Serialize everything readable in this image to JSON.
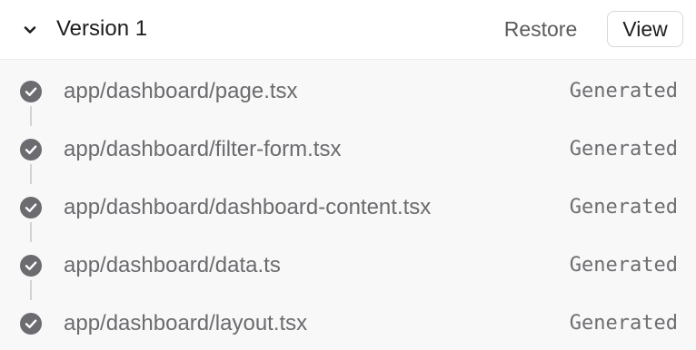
{
  "header": {
    "expand_icon": "chevron-down-icon",
    "title": "Version 1",
    "restore_label": "Restore",
    "view_label": "View"
  },
  "files": [
    {
      "path": "app/dashboard/page.tsx",
      "status": "Generated",
      "icon": "check-circle-icon"
    },
    {
      "path": "app/dashboard/filter-form.tsx",
      "status": "Generated",
      "icon": "check-circle-icon"
    },
    {
      "path": "app/dashboard/dashboard-content.tsx",
      "status": "Generated",
      "icon": "check-circle-icon"
    },
    {
      "path": "app/dashboard/data.ts",
      "status": "Generated",
      "icon": "check-circle-icon"
    },
    {
      "path": "app/dashboard/layout.tsx",
      "status": "Generated",
      "icon": "check-circle-icon"
    }
  ],
  "colors": {
    "check_fill": "#6b6b70",
    "path_text": "#6b6b6f",
    "connector": "#d3d3d6",
    "list_background": "#f8f8f8"
  }
}
